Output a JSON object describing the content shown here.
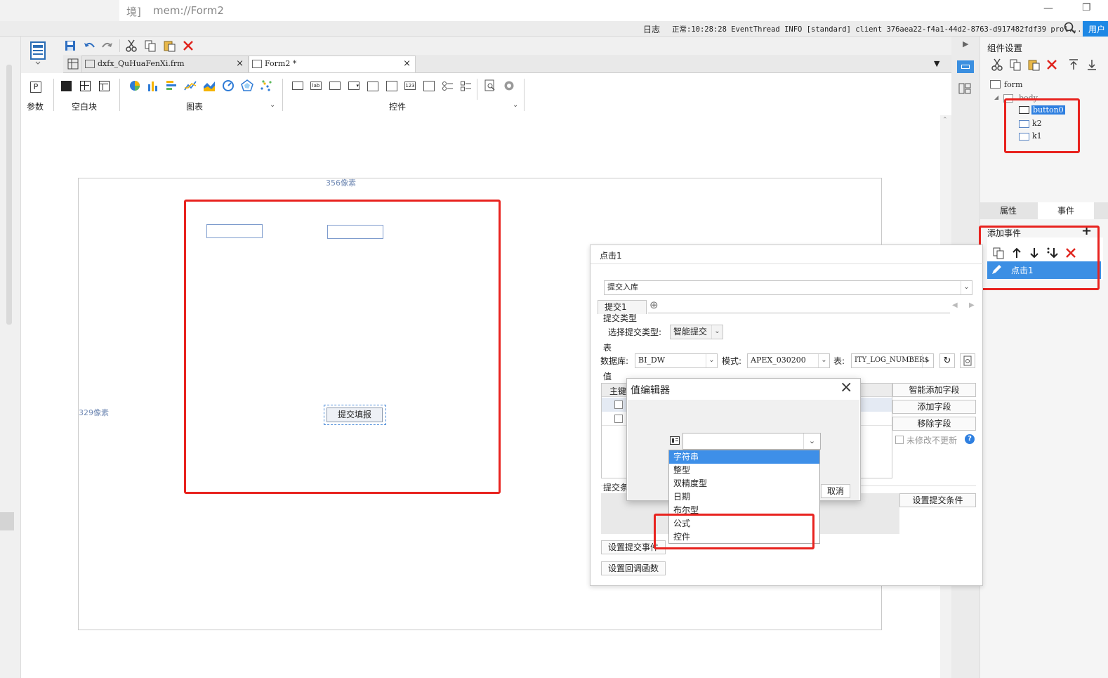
{
  "title_bar": {
    "env_label": "境]",
    "doc": "mem://Form2"
  },
  "status_bar": {
    "log_label": "日志",
    "log_text": "正常:10:28:28 EventThread INFO [standard] client 376aea22-f4a1-44d2-8763-d917482fdf39 prol...",
    "user_label": "用户"
  },
  "tabs": [
    {
      "label": "dxfx_QuHuaFenXi.frm"
    },
    {
      "label": "Form2 *"
    }
  ],
  "toolbar_groups": {
    "param": "参数",
    "blank": "空白块",
    "chart": "图表",
    "control": "控件"
  },
  "canvas": {
    "width_label": "356像素",
    "height_label": "329像素",
    "submit_button": "提交填报"
  },
  "right_panel": {
    "title": "组件设置",
    "tree": {
      "form": "form",
      "body": "body",
      "items": [
        "button0",
        "k2",
        "k1"
      ]
    },
    "tabs": [
      "属性",
      "事件"
    ],
    "add_event": "添加事件",
    "event_item": "点击1"
  },
  "click_dialog": {
    "title": "点击1",
    "action": "提交入库",
    "subtab": "提交1",
    "submit_type_section": "提交类型",
    "submit_type_label": "选择提交类型:",
    "submit_type_value": "智能提交",
    "table_section": "表",
    "db_label": "数据库:",
    "db_value": "BI_DW",
    "schema_label": "模式:",
    "schema_value": "APEX_030200",
    "table_label": "表:",
    "table_value": "ITY_LOG_NUMBER$",
    "value_section": "值",
    "key_col": "主键",
    "btn_smart_add": "智能添加字段",
    "btn_add": "添加字段",
    "btn_remove": "移除字段",
    "unchanged_label": "未修改不更新",
    "cond_label": "提交条",
    "btn_set_cond": "设置提交条件",
    "btn_set_event": "设置提交事件",
    "btn_callback": "设置回调函数"
  },
  "value_editor": {
    "title": "值编辑器",
    "cancel": "取消",
    "options": [
      "字符串",
      "整型",
      "双精度型",
      "日期",
      "布尔型",
      "公式",
      "控件"
    ]
  }
}
